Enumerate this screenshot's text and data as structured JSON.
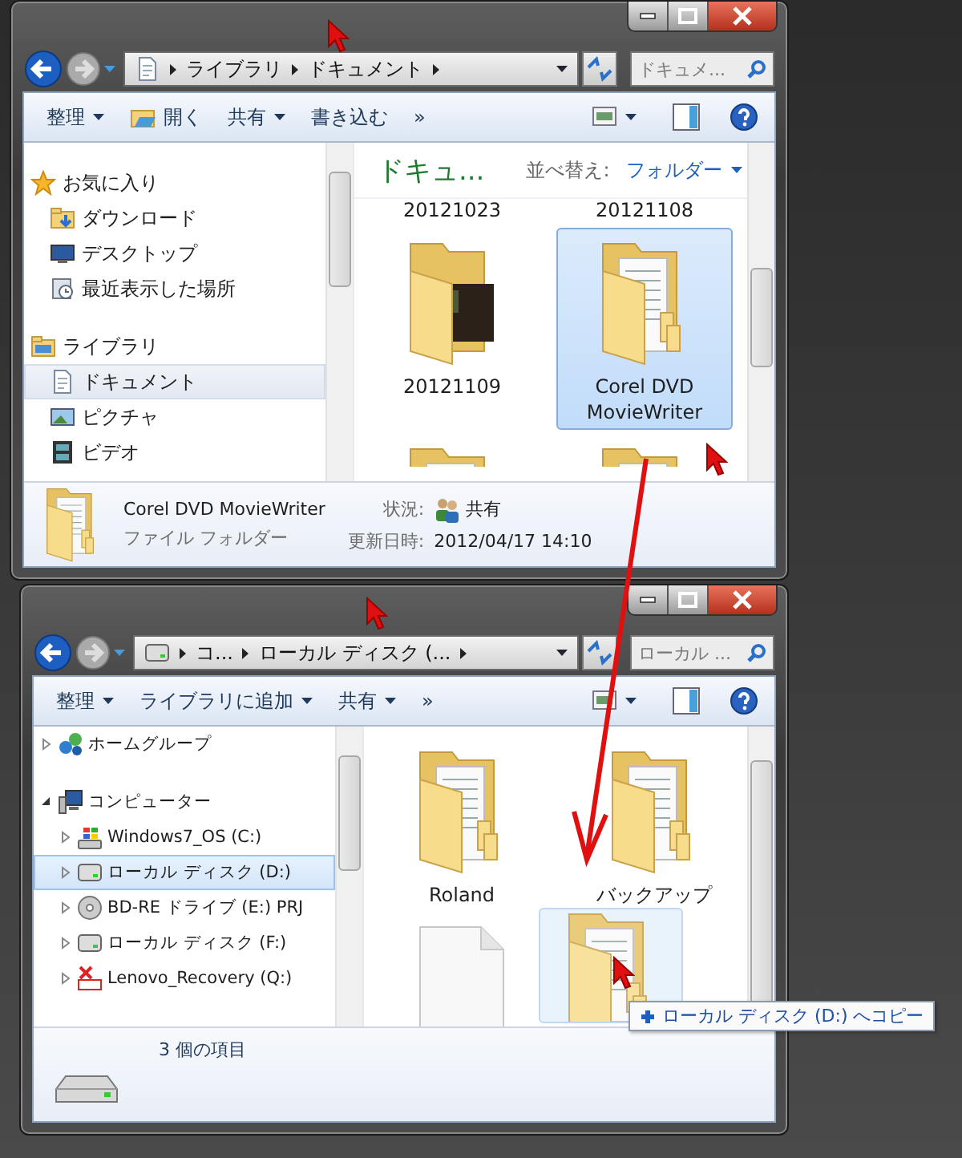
{
  "windows": [
    {
      "address": {
        "kind": "library",
        "crumbs": [
          "ライブラリ",
          "ドキュメント"
        ]
      },
      "search": {
        "placeholder": "ドキュメ..."
      },
      "toolbar": [
        {
          "label": "整理",
          "kind": "menu"
        },
        {
          "label": "開く",
          "kind": "open"
        },
        {
          "label": "共有",
          "kind": "menu"
        },
        {
          "label": "書き込む",
          "kind": "plain"
        },
        {
          "label": "»",
          "kind": "plain"
        }
      ],
      "nav_pane": {
        "items": [
          {
            "label": "お気に入り",
            "kind": "favorites",
            "selected": false,
            "children": [
              {
                "label": "ダウンロード",
                "kind": "download",
                "selected": false
              },
              {
                "label": "デスクトップ",
                "kind": "desktop",
                "selected": false
              },
              {
                "label": "最近表示した場所",
                "kind": "recent",
                "selected": false
              }
            ]
          },
          {
            "label": "ライブラリ",
            "kind": "library",
            "selected": false,
            "children": [
              {
                "label": "ドキュメント",
                "kind": "document",
                "selected": true
              },
              {
                "label": "ピクチャ",
                "kind": "picture",
                "selected": false
              },
              {
                "label": "ビデオ",
                "kind": "video",
                "selected": false
              }
            ]
          }
        ]
      },
      "content": {
        "title": "ドキュ...",
        "sort_label": "並べ替え:",
        "sort_value": "フォルダー",
        "items": [
          {
            "label": "20121023",
            "kind": "label",
            "selected": false
          },
          {
            "label": "20121108",
            "kind": "label",
            "selected": false
          },
          {
            "label": "20121109",
            "kind": "photo-folder",
            "selected": false
          },
          {
            "label": "Corel DVD MovieWriter",
            "kind": "folder",
            "selected": true
          },
          {
            "kind": "folder-cut",
            "selected": false
          },
          {
            "kind": "folder-cut",
            "selected": false
          }
        ]
      },
      "details": {
        "kind": "folder",
        "name": "Corel DVD MovieWriter",
        "type": "ファイル フォルダー",
        "properties": [
          {
            "label": "状況:",
            "value": "共有",
            "kind": "shared"
          },
          {
            "label": "更新日時:",
            "value": "2012/04/17 14:10",
            "kind": "plain"
          }
        ]
      }
    },
    {
      "address": {
        "kind": "drive",
        "crumbs": [
          "コ...",
          "ローカル ディスク (..."
        ]
      },
      "search": {
        "placeholder": "ローカル ..."
      },
      "toolbar": [
        {
          "label": "整理",
          "kind": "menu"
        },
        {
          "label": "ライブラリに追加",
          "kind": "menu"
        },
        {
          "label": "共有",
          "kind": "menu"
        },
        {
          "label": "»",
          "kind": "plain"
        }
      ],
      "nav_pane": {
        "items": [
          {
            "label": "ホームグループ",
            "kind": "homegroup",
            "selected": false,
            "expanded": false
          },
          {
            "label": "コンピューター",
            "kind": "computer",
            "selected": false,
            "expanded": true,
            "children": [
              {
                "label": "Windows7_OS (C:)",
                "kind": "system-drive",
                "selected": false,
                "expanded": false
              },
              {
                "label": "ローカル ディスク (D:)",
                "kind": "drive",
                "selected": true,
                "expanded": false
              },
              {
                "label": "BD-RE ドライブ (E:) PRJ",
                "kind": "optical",
                "selected": false,
                "expanded": false
              },
              {
                "label": "ローカル ディスク (F:)",
                "kind": "drive",
                "selected": false,
                "expanded": false
              },
              {
                "label": "Lenovo_Recovery (Q:)",
                "kind": "recovery",
                "selected": false,
                "expanded": false
              }
            ]
          }
        ]
      },
      "content": {
        "items": [
          {
            "label": "Roland",
            "kind": "folder",
            "selected": false
          },
          {
            "label": "バックアップ",
            "kind": "folder",
            "selected": false
          },
          {
            "kind": "file",
            "selected": false
          }
        ]
      },
      "details": {
        "kind": "drive",
        "summary": "3 個の項目"
      },
      "drag": {
        "label": "ローカル ディスク (D:) へコピー"
      }
    }
  ]
}
